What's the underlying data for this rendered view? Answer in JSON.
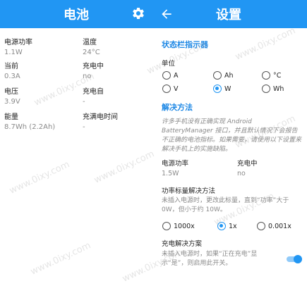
{
  "battery": {
    "title": "电池",
    "icon": "gear-icon",
    "stats": [
      {
        "label": "电源功率",
        "value": "1.1W"
      },
      {
        "label": "温度",
        "value": "24°C"
      },
      {
        "label": "当前",
        "value": "0.3A"
      },
      {
        "label": "充电中",
        "value": "no"
      },
      {
        "label": "电压",
        "value": "3.9V"
      },
      {
        "label": "充电自",
        "value": "-"
      },
      {
        "label": "能量",
        "value": "8.7Wh (2.2Ah)"
      },
      {
        "label": "充满电时间",
        "value": "-"
      }
    ]
  },
  "settings": {
    "title": "设置",
    "back_icon": "arrow-back-icon",
    "status_section": "状态栏指示器",
    "unit_label": "单位",
    "units": [
      {
        "label": "A",
        "selected": false
      },
      {
        "label": "Ah",
        "selected": false
      },
      {
        "label": "°C",
        "selected": false
      },
      {
        "label": "V",
        "selected": false
      },
      {
        "label": "W",
        "selected": true
      },
      {
        "label": "Wh",
        "selected": false
      }
    ],
    "workaround_section": "解决方法",
    "workaround_desc": "许多手机没有正确实现 Android BatteryManager 接口，并且默认情况下会报告不正确的电池指标。如果需要，请使用以下设置来解决手机上的实施缺陷。",
    "power_label": "电源功率",
    "power_value": "1.5W",
    "charging_label": "充电中",
    "charging_value": "no",
    "scale_label": "功率标量解决方法",
    "scale_desc": "未插入电源时，更改此标量，直到“功率”大于 0W，但小于约 10W。",
    "scales": [
      {
        "label": "1000x",
        "selected": false
      },
      {
        "label": "1x",
        "selected": true
      },
      {
        "label": "0.001x",
        "selected": false
      }
    ],
    "charge_fix_label": "充电解决方案",
    "charge_fix_desc": "未插入电源时，如果“正在充电”显示“是”，则启用此开关。",
    "charge_fix_enabled": true
  },
  "watermark": "www.0ixy.com",
  "colors": {
    "accent": "#2196f3",
    "section": "#1e88e5"
  }
}
